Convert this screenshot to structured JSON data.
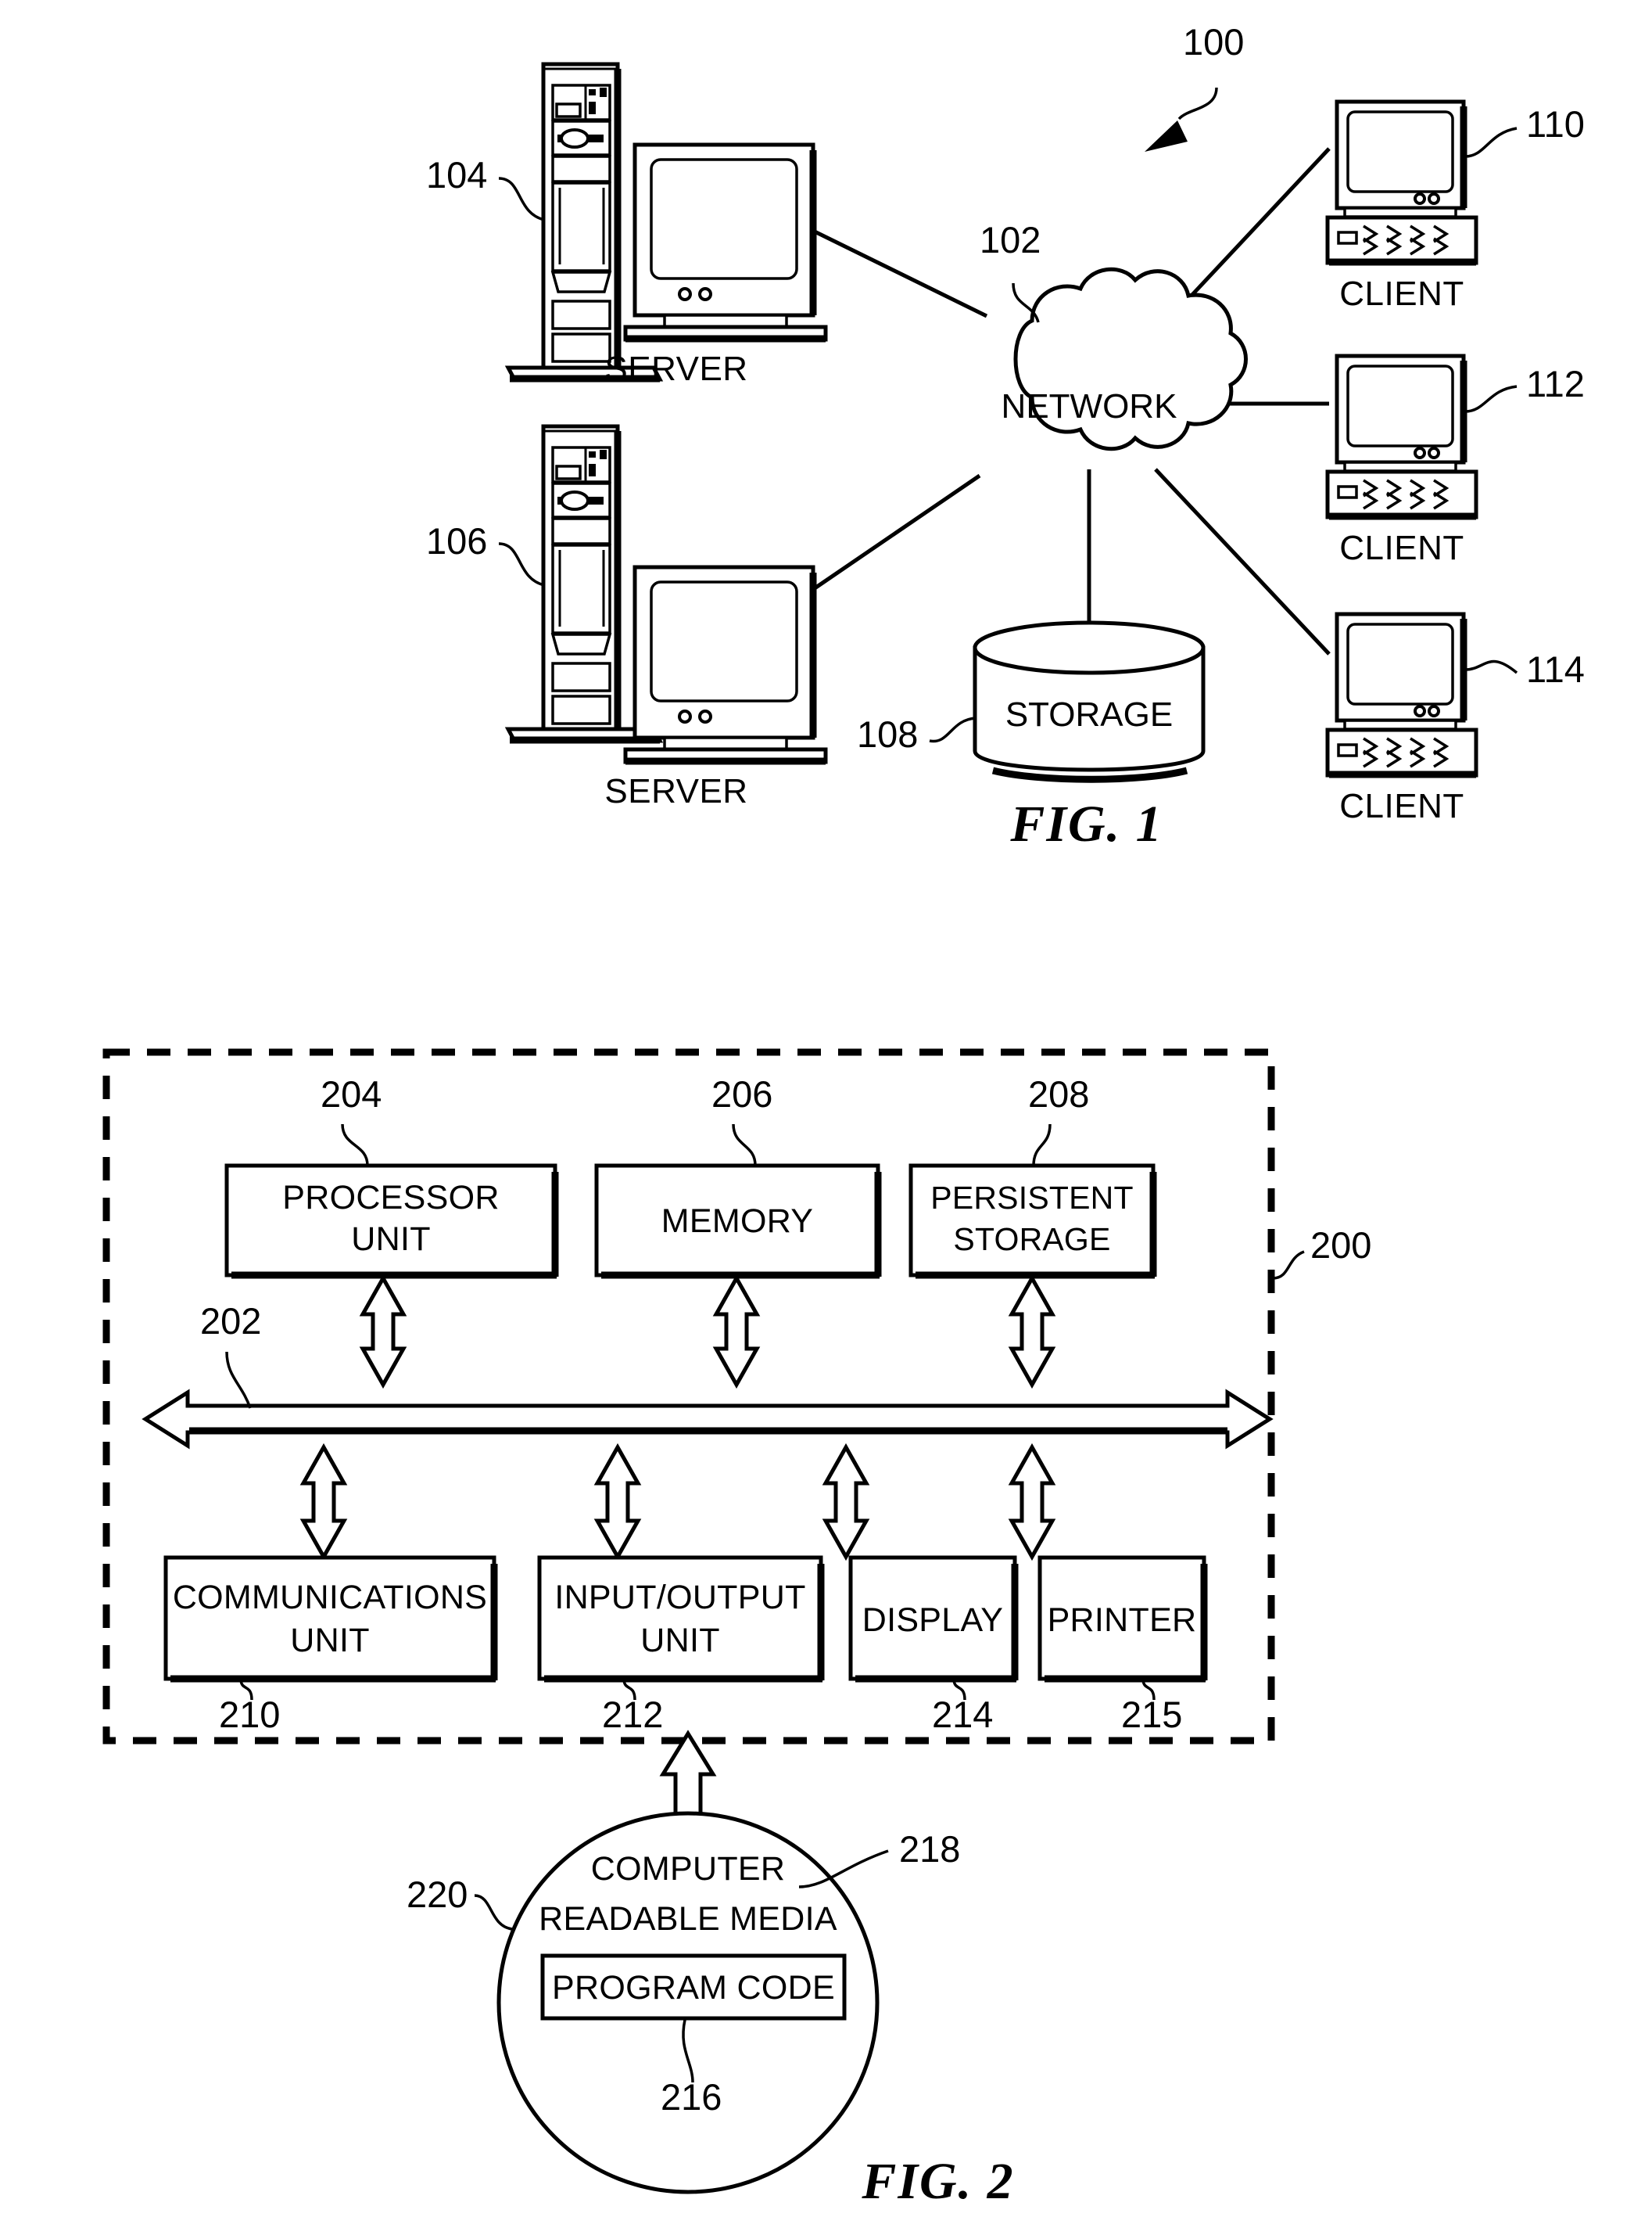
{
  "document": {
    "type": "patent-drawing-sheet",
    "figures": [
      "FIG. 1",
      "FIG. 2"
    ]
  },
  "figure1": {
    "caption": "FIG. 1",
    "system_ref": "100",
    "network": {
      "label": "NETWORK",
      "ref": "102"
    },
    "servers": [
      {
        "label": "SERVER",
        "ref": "104"
      },
      {
        "label": "SERVER",
        "ref": "106"
      }
    ],
    "storage": {
      "label": "STORAGE",
      "ref": "108"
    },
    "clients": [
      {
        "label": "CLIENT",
        "ref": "110"
      },
      {
        "label": "CLIENT",
        "ref": "112"
      },
      {
        "label": "CLIENT",
        "ref": "114"
      }
    ]
  },
  "figure2": {
    "caption": "FIG. 2",
    "data_processing_system_ref": "200",
    "bus_ref": "202",
    "top_components": [
      {
        "lines": [
          "PROCESSOR",
          "UNIT"
        ],
        "ref": "204"
      },
      {
        "lines": [
          "MEMORY"
        ],
        "ref": "206"
      },
      {
        "lines": [
          "PERSISTENT",
          "STORAGE"
        ],
        "ref": "208"
      }
    ],
    "bottom_components": [
      {
        "lines": [
          "COMMUNICATIONS",
          "UNIT"
        ],
        "ref": "210"
      },
      {
        "lines": [
          "INPUT/OUTPUT",
          "UNIT"
        ],
        "ref": "212"
      },
      {
        "lines": [
          "DISPLAY"
        ],
        "ref": "214"
      },
      {
        "lines": [
          "PRINTER"
        ],
        "ref": "215"
      }
    ],
    "media": {
      "lines": [
        "COMPUTER",
        "READABLE MEDIA"
      ],
      "ref": "218",
      "outer_ref": "220",
      "program_code": {
        "label": "PROGRAM CODE",
        "ref": "216"
      }
    }
  },
  "colors": {
    "ink": "#000000",
    "paper": "#ffffff"
  }
}
